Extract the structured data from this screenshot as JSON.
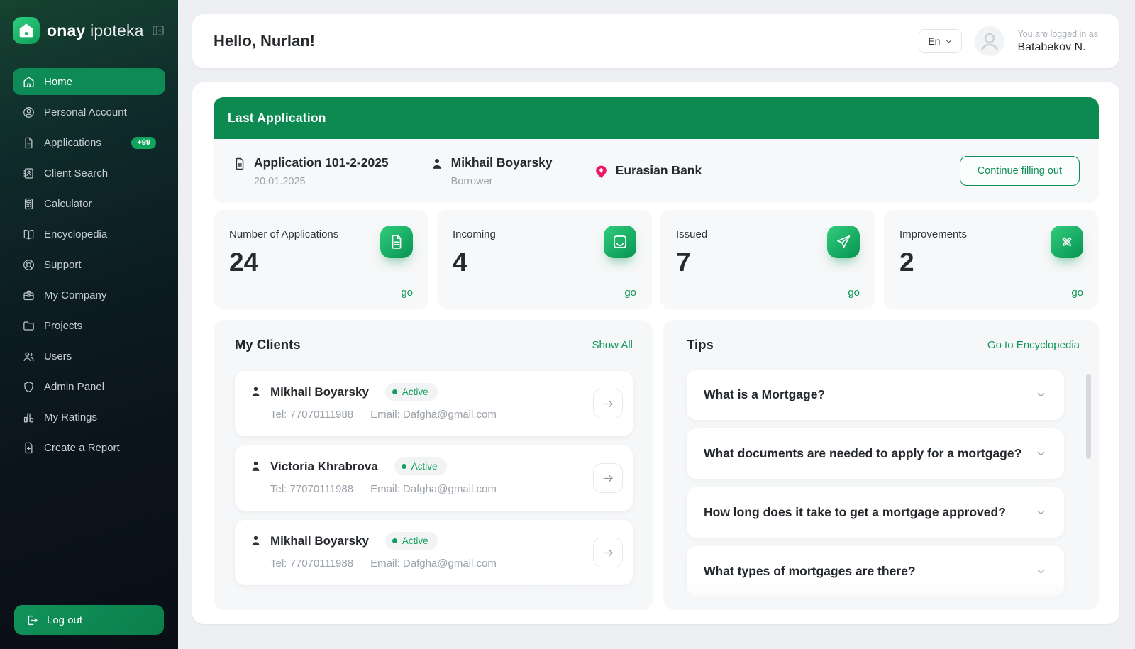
{
  "sidebar": {
    "brand_bold": "onay",
    "brand_light": "ipoteka",
    "items": [
      {
        "label": "Home",
        "icon": "home-icon",
        "active": true
      },
      {
        "label": "Personal Account",
        "icon": "person-circle-icon"
      },
      {
        "label": "Applications",
        "icon": "document-icon",
        "badge": "+99"
      },
      {
        "label": "Client Search",
        "icon": "contact-book-icon"
      },
      {
        "label": "Calculator",
        "icon": "calculator-icon"
      },
      {
        "label": "Encyclopedia",
        "icon": "open-book-icon"
      },
      {
        "label": "Support",
        "icon": "lifebuoy-icon"
      },
      {
        "label": "My Company",
        "icon": "briefcase-icon"
      },
      {
        "label": "Projects",
        "icon": "folder-icon"
      },
      {
        "label": "Users",
        "icon": "users-icon"
      },
      {
        "label": "Admin Panel",
        "icon": "shield-icon"
      },
      {
        "label": "My Ratings",
        "icon": "bar-chart-icon"
      },
      {
        "label": "Create a Report",
        "icon": "file-plus-icon"
      }
    ],
    "logout_label": "Log out"
  },
  "header": {
    "greeting": "Hello, Nurlan!",
    "language": "En",
    "login_caption": "You are logged in as",
    "user_name": "Batabekov N."
  },
  "last_application": {
    "title": "Last Application",
    "application_number": "Application 101-2-2025",
    "date": "20.01.2025",
    "borrower_name": "Mikhail Boyarsky",
    "borrower_role": "Borrower",
    "bank_name": "Eurasian Bank",
    "button_label": "Continue filling out"
  },
  "stats": [
    {
      "label": "Number of Applications",
      "value": "24",
      "link": "go",
      "icon": "file-icon"
    },
    {
      "label": "Incoming",
      "value": "4",
      "link": "go",
      "icon": "inbox-icon"
    },
    {
      "label": "Issued",
      "value": "7",
      "link": "go",
      "icon": "paper-plane-icon"
    },
    {
      "label": "Improvements",
      "value": "2",
      "link": "go",
      "icon": "crossed-pencils-icon"
    }
  ],
  "clients": {
    "title": "My Clients",
    "show_all": "Show All",
    "list": [
      {
        "name": "Mikhail Boyarsky",
        "status": "Active",
        "tel": "Tel: 77070111988",
        "email": "Email: Dafgha@gmail.com"
      },
      {
        "name": "Victoria Khrabrova",
        "status": "Active",
        "tel": "Tel: 77070111988",
        "email": "Email: Dafgha@gmail.com"
      },
      {
        "name": "Mikhail Boyarsky",
        "status": "Active",
        "tel": "Tel: 77070111988",
        "email": "Email: Dafgha@gmail.com"
      }
    ]
  },
  "tips": {
    "title": "Tips",
    "link": "Go to Encyclopedia",
    "questions": [
      "What is a Mortgage?",
      "What documents are needed to apply for a mortgage?",
      "How long does it take to get a mortgage approved?",
      "What types of mortgages are there?"
    ]
  },
  "colors": {
    "accent_green": "#0d8f56",
    "banner_green": "#0c8a52",
    "active_menu_green": "#0d8a55",
    "badge_green": "#0fa55d",
    "status_green": "#13a05e",
    "icon_tile_gradient_from": "#31cd7c",
    "icon_tile_gradient_to": "#0d9c58",
    "bank_pink": "#ec1566",
    "sidebar_dark": "#0a0f16",
    "page_background": "#edeff2",
    "panel_gray": "#f6f7f8"
  }
}
